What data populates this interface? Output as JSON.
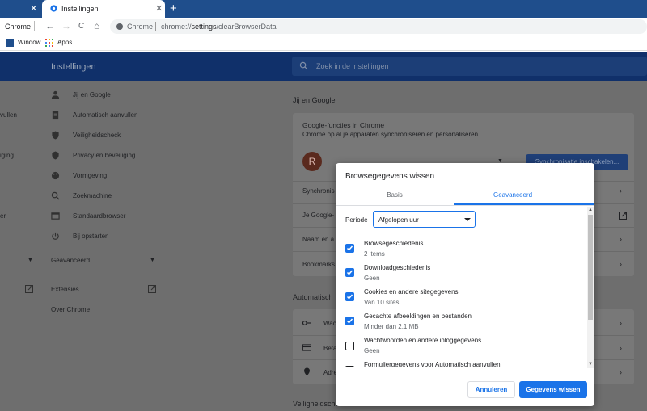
{
  "tabs": {
    "prev_close": "✕",
    "active_title": "Instellingen",
    "active_close": "✕",
    "new_tab": "+"
  },
  "toolbar": {
    "prev_label": "Chrome",
    "back": "←",
    "forward": "→",
    "reload": "C",
    "home": "⌂",
    "omni_site": "Chrome",
    "omni_url_prefix": "chrome://",
    "omni_url_host": "settings",
    "omni_url_path": "/clearBrowserData"
  },
  "bookmarks": {
    "item1": "Window",
    "item2": "Apps"
  },
  "settings": {
    "title": "Instellingen",
    "search_placeholder": "Zoek in de instellingen",
    "left_fragments": [
      "vullen",
      "iging",
      "er"
    ],
    "nav": [
      "Jij en Google",
      "Automatisch aanvullen",
      "Veiligheidscheck",
      "Privacy en beveiliging",
      "Vormgeving",
      "Zoekmachine",
      "Standaardbrowser",
      "Bij opstarten"
    ],
    "advanced": "Geavanceerd",
    "extensions": "Extensies",
    "about": "Over Chrome"
  },
  "main": {
    "section_you_google": "Jij en Google",
    "google_features_title": "Google-functies in Chrome",
    "google_features_sub": "Chrome op al je apparaten synchroniseren en personaliseren",
    "avatar_letter": "R",
    "sync_button": "Synchronisatie inschakelen...",
    "rows_you": [
      "Synchronis",
      "Je Google-",
      "Naam en a",
      "Bookmarks"
    ],
    "section_autofill": "Automatisch",
    "rows_autofill": [
      "Wac",
      "Beta",
      "Adre"
    ],
    "section_safety": "Veiligheidscheck"
  },
  "dialog": {
    "title": "Browsegegevens wissen",
    "tab_basic": "Basis",
    "tab_advanced": "Geavanceerd",
    "period_label": "Periode",
    "period_value": "Afgelopen uur",
    "options": [
      {
        "title": "Browsegeschiedenis",
        "sub": "2 items",
        "checked": true
      },
      {
        "title": "Downloadgeschiedenis",
        "sub": "Geen",
        "checked": true
      },
      {
        "title": "Cookies en andere sitegegevens",
        "sub": "Van 10 sites",
        "checked": true
      },
      {
        "title": "Gecachte afbeeldingen en bestanden",
        "sub": "Minder dan 2,1 MB",
        "checked": true
      },
      {
        "title": "Wachtwoorden en andere inloggegevens",
        "sub": "Geen",
        "checked": false
      },
      {
        "title": "Formuliergegevens voor Automatisch aanvullen",
        "sub": "",
        "checked": false
      }
    ],
    "cancel": "Annuleren",
    "clear": "Gegevens wissen"
  },
  "colors": {
    "accent": "#1a73e8",
    "header": "#10306a"
  }
}
